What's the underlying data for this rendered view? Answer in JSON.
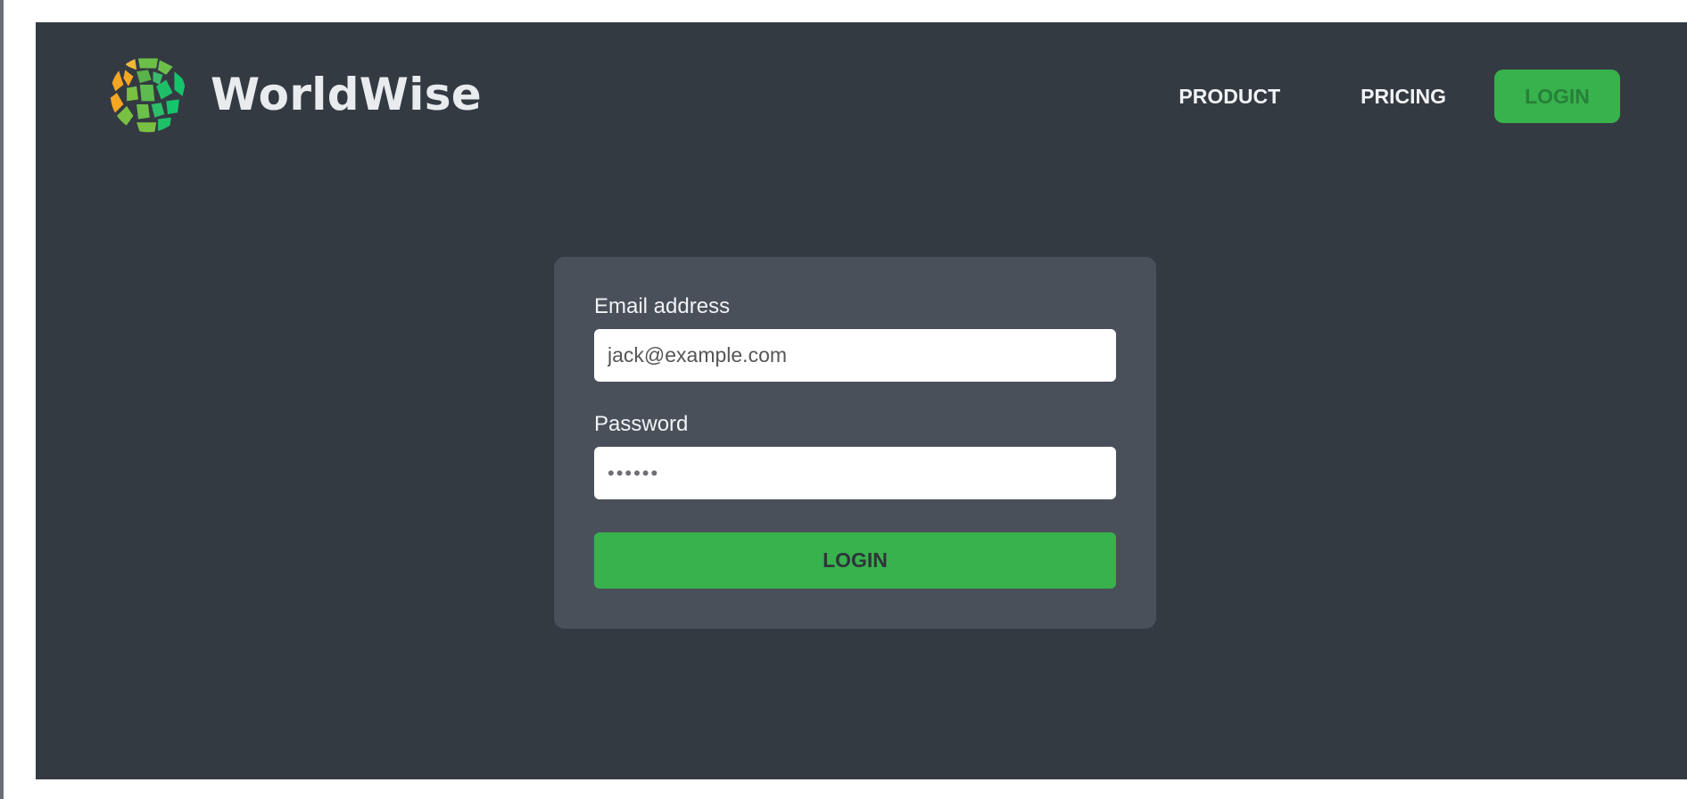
{
  "header": {
    "logo_text": "WorldWise",
    "nav": {
      "product_label": "PRODUCT",
      "pricing_label": "PRICING",
      "login_label": "LOGIN"
    }
  },
  "login_form": {
    "email": {
      "label": "Email address",
      "value": "jack@example.com"
    },
    "password": {
      "label": "Password",
      "value": "••••••"
    },
    "submit_label": "LOGIN"
  },
  "colors": {
    "background": "#343a42",
    "card": "#49505a",
    "accent": "#38b24c",
    "text_light": "#f1f3f5"
  },
  "icons": {
    "logo": "worldwise-globe-icon"
  }
}
